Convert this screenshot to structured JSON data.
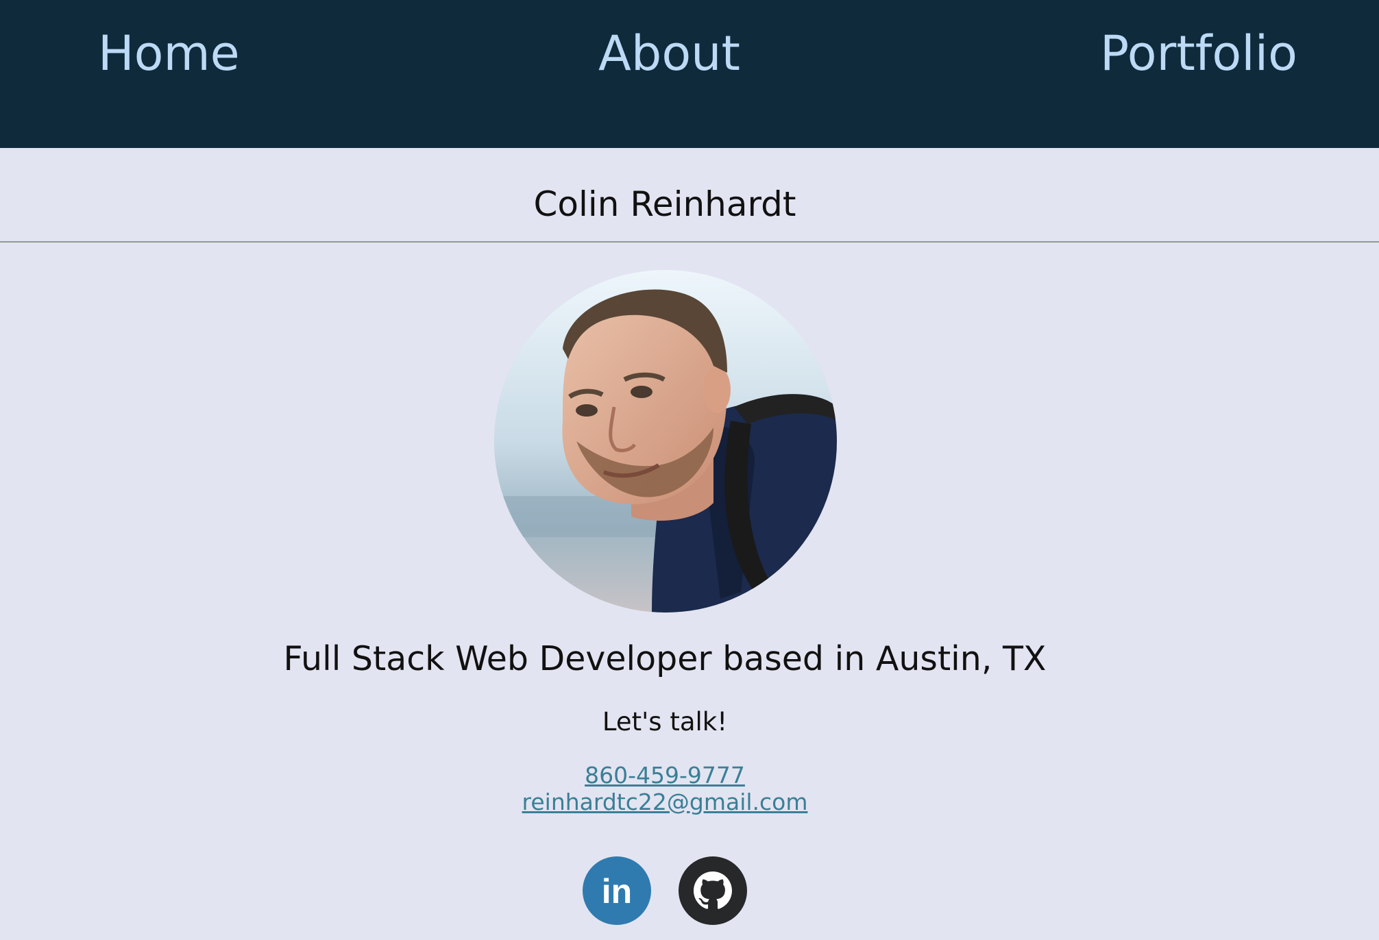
{
  "nav": {
    "items": [
      {
        "id": "home",
        "label": "Home"
      },
      {
        "id": "about",
        "label": "About"
      },
      {
        "id": "portfolio",
        "label": "Portfolio"
      }
    ]
  },
  "header": {
    "name": "Colin Reinhardt"
  },
  "profile": {
    "avatar_icon": "profile-photo",
    "tagline": "Full Stack Web Developer based in Austin, TX",
    "cta": "Let's talk!"
  },
  "contact": {
    "phone": "860-459-9777",
    "email": "reinhardtc22@gmail.com"
  },
  "social": {
    "linkedin": {
      "icon": "linkedin-icon",
      "glyph": "in",
      "color": "#2f7bb0"
    },
    "github": {
      "icon": "github-icon",
      "color": "#262829"
    }
  },
  "colors": {
    "navbar": "#0f2a3a",
    "nav_text": "#bcd9f5",
    "background": "#e3e4f1",
    "link": "#3a7f96"
  }
}
